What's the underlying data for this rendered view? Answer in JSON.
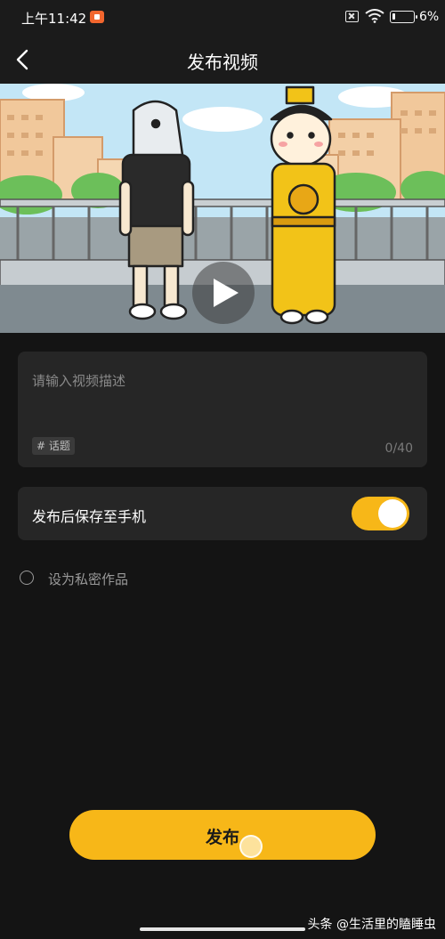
{
  "status_bar": {
    "time": "上午11:42",
    "battery_percent": "6%",
    "icons": [
      "screen-record-icon",
      "sim-no-service-icon",
      "wifi-icon",
      "battery-icon"
    ]
  },
  "header": {
    "back_icon": "chevron-left-icon",
    "title": "发布视频"
  },
  "video_preview": {
    "play_icon": "play-icon"
  },
  "description": {
    "placeholder": "请输入视频描述",
    "topic_tag": "# 话题",
    "char_count": "0/40"
  },
  "save_to_phone": {
    "label": "发布后保存至手机",
    "enabled": true
  },
  "private_option": {
    "label": "设为私密作品",
    "checked": false
  },
  "publish_button": {
    "label": "发布"
  },
  "watermark": "头条 @生活里的瞌睡虫",
  "colors": {
    "background": "#141414",
    "card": "#262626",
    "accent": "#f7b718",
    "muted_text": "#8a8a8a"
  }
}
